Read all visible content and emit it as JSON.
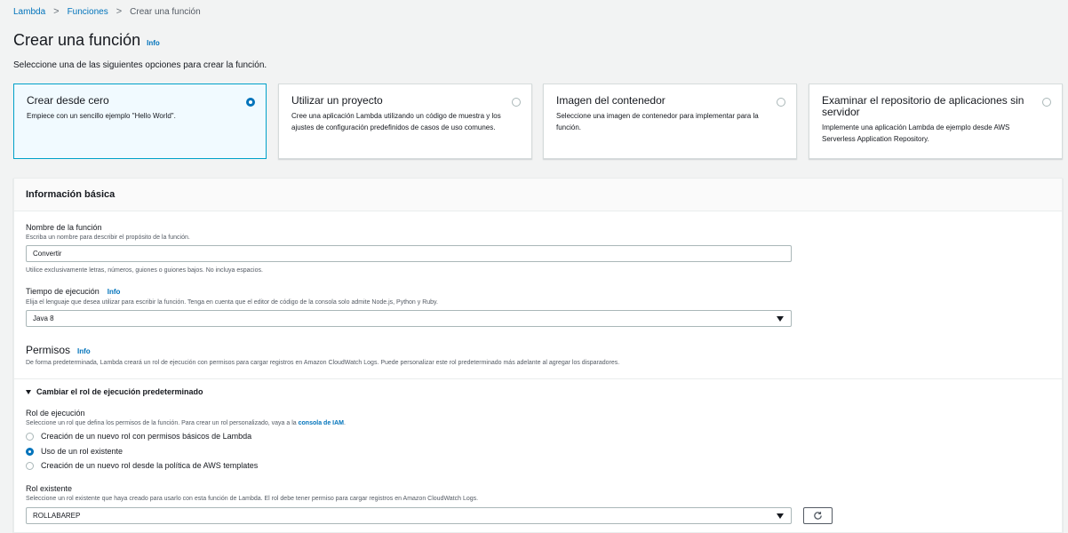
{
  "breadcrumb": {
    "items": [
      "Lambda",
      "Funciones",
      "Crear una función"
    ],
    "separator": ">"
  },
  "page": {
    "title": "Crear una función",
    "info": "Info",
    "subtitle": "Seleccione una de las siguientes opciones para crear la función."
  },
  "options": [
    {
      "title": "Crear desde cero",
      "description": "Empiece con un sencillo ejemplo \"Hello World\".",
      "selected": true
    },
    {
      "title": "Utilizar un proyecto",
      "description": "Cree una aplicación Lambda utilizando un código de muestra y los ajustes de configuración predefinidos de casos de uso comunes.",
      "selected": false
    },
    {
      "title": "Imagen del contenedor",
      "description": "Seleccione una imagen de contenedor para implementar para la función.",
      "selected": false
    },
    {
      "title": "Examinar el repositorio de aplicaciones sin servidor",
      "description": "Implemente una aplicación Lambda de ejemplo desde AWS Serverless Application Repository.",
      "selected": false
    }
  ],
  "basic_info": {
    "header": "Información básica",
    "function_name": {
      "label": "Nombre de la función",
      "description": "Escriba un nombre para describir el propósito de la función.",
      "value": "Convertir",
      "constraint": "Utilice exclusivamente letras, números, guiones o guiones bajos. No incluya espacios."
    },
    "runtime": {
      "label": "Tiempo de ejecución",
      "info": "Info",
      "description": "Elija el lenguaje que desea utilizar para escribir la función. Tenga en cuenta que el editor de código de la consola solo admite Node.js, Python y Ruby.",
      "value": "Java 8"
    },
    "permissions": {
      "title": "Permisos",
      "info": "Info",
      "description": "De forma predeterminada, Lambda creará un rol de ejecución con permisos para cargar registros en Amazon CloudWatch Logs. Puede personalizar este rol predeterminado más adelante al agregar los disparadores."
    },
    "change_role": {
      "label": "Cambiar el rol de ejecución predeterminado",
      "execution_role_label": "Rol de ejecución",
      "execution_role_desc_prefix": "Seleccione un rol que defina los permisos de la función. Para crear un rol personalizado, vaya a la",
      "iam_link": "consola de IAM",
      "radios": [
        {
          "label": "Creación de un nuevo rol con permisos básicos de Lambda",
          "checked": false
        },
        {
          "label": "Uso de un rol existente",
          "checked": true
        },
        {
          "label": "Creación de un nuevo rol desde la política de AWS templates",
          "checked": false
        }
      ],
      "existing_role_label": "Rol existente",
      "existing_role_desc": "Seleccione un rol existente que haya creado para usarlo con esta función de Lambda. El rol debe tener permiso para cargar registros en Amazon CloudWatch Logs.",
      "existing_role_value": "ROLLABAREP"
    }
  },
  "colors": {
    "link": "#0073bb",
    "selected_border": "#00a1c9",
    "selected_bg": "#f1faff"
  }
}
